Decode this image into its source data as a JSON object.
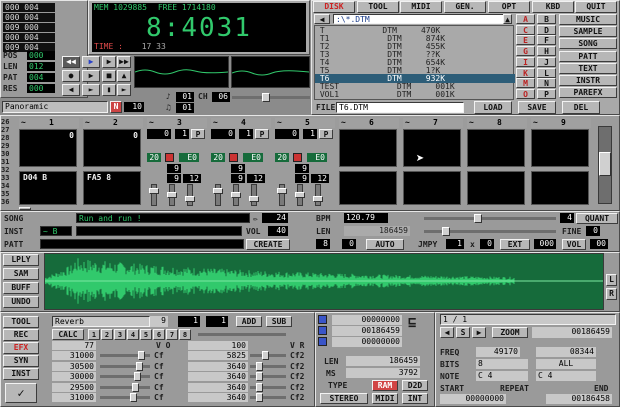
{
  "status": {
    "mem_label": "MEM",
    "mem_value": "1029885",
    "free_label": "FREE",
    "free_value": "1714180",
    "big_counter": "8:4031",
    "time_label": "TIME :",
    "time_value": "17 33",
    "left_digits": [
      "000 004",
      "000 004",
      "009 000",
      "000 004",
      "009 004"
    ]
  },
  "transport": {
    "labels": [
      {
        "name": "pos",
        "label": "POS",
        "value": "000"
      },
      {
        "name": "len",
        "label": "LEN",
        "value": "012"
      },
      {
        "name": "pat",
        "label": "PAT",
        "value": "004"
      },
      {
        "name": "res",
        "label": "RES",
        "value": "000"
      }
    ],
    "panoramic": "Panoramic",
    "n_label": "N",
    "n_value": "10",
    "oct_value": "01",
    "ch_label": "CH",
    "ch_value": "06",
    "ch2_value": "01"
  },
  "menu": {
    "tabs": [
      "DISK",
      "TOOL",
      "MIDI",
      "GEN.",
      "OPT",
      "KBD",
      "QUIT"
    ]
  },
  "disk": {
    "path": ":\\*.DTM",
    "files": [
      {
        "name": "T",
        "type": "DTM",
        "size": "470K"
      },
      {
        "name": "T1",
        "type": "DTM",
        "size": "874K"
      },
      {
        "name": "T2",
        "type": "DTM",
        "size": "455K"
      },
      {
        "name": "T3",
        "type": "DTM",
        "size": "??K"
      },
      {
        "name": "T4",
        "type": "DTM",
        "size": "654K"
      },
      {
        "name": "T5",
        "type": "DTM",
        "size": "1?K"
      },
      {
        "name": "T6",
        "type": "DTM",
        "size": "932K"
      },
      {
        "name": "TEST",
        "type": "DTM",
        "size": "001K"
      },
      {
        "name": "VOL1",
        "type": "DTM",
        "size": "001K"
      }
    ],
    "selected_index": 6,
    "drive_letters": [
      "A",
      "C",
      "E",
      "G",
      "I",
      "K",
      "M",
      "O",
      "B",
      "D",
      "F",
      "H",
      "J",
      "L",
      "N",
      "P"
    ],
    "file_label": "FILE",
    "file_value": "T6.DTM",
    "load": "LOAD",
    "save": "SAVE",
    "del": "DEL",
    "right_buttons": [
      "MUSIC",
      "SAMPLE",
      "SONG",
      "PATT",
      "TEXT",
      "INSTR",
      "PAREFX"
    ]
  },
  "tracks": {
    "numbers": [
      "1",
      "2",
      "3",
      "4",
      "5",
      "6",
      "7",
      "8",
      "9"
    ],
    "left_rows": [
      "26",
      "27",
      "28",
      "29",
      "30",
      "31",
      "32",
      "33",
      "34",
      "35",
      "36"
    ],
    "slot_values": [
      [
        "0",
        "",
        "0"
      ],
      [
        "0",
        "",
        "0"
      ],
      [
        "0",
        "1",
        "P"
      ],
      [
        "0",
        "1",
        "P"
      ],
      [
        "0",
        "1",
        "P"
      ],
      [
        "",
        "",
        ""
      ],
      [
        "",
        "",
        ""
      ],
      [
        "",
        "",
        ""
      ],
      [
        "",
        "",
        ""
      ]
    ],
    "mix_values": [
      {
        "a": "20",
        "b": "E0",
        "c": "9",
        "d": "9",
        "e": "12"
      },
      {
        "a": "20",
        "b": "E0",
        "c": "9",
        "d": "9",
        "e": "12"
      },
      {
        "a": "20",
        "b": "E0",
        "c": "9",
        "d": "9",
        "e": "12"
      }
    ],
    "notes": [
      {
        "track": "1",
        "text": "D04 B"
      },
      {
        "track": "2",
        "text": "FA5 8"
      }
    ]
  },
  "song": {
    "song_label": "SONG",
    "song_text": "Run and run !",
    "speed_value": "24",
    "bpm_label": "BPM",
    "bpm_value": "120.79",
    "quant_value": "4",
    "quant_label": "QUANT",
    "inst_label": "INST",
    "inst_value": "~ B",
    "vol_label": "VOL",
    "vol_value": "40",
    "len_label": "LEN",
    "len_value": "186459",
    "fine_label": "FINE",
    "fine_value": "0",
    "patt_label": "PATT",
    "create": "CREATE",
    "create_value": "8",
    "create_value2": "0",
    "auto": "AUTO",
    "jmpy_label": "JMPY",
    "jmpy_value": "1",
    "x_value": "0",
    "ext": "EXT",
    "ext_value": "000",
    "vol2_value": "00"
  },
  "sample_buttons": [
    "LPLY",
    "SAM",
    "BUFF",
    "UNDO"
  ],
  "sample_side": [
    "L",
    "R"
  ],
  "effects": {
    "left_buttons": [
      "TOOL",
      "REC",
      "EFX",
      "SYN",
      "INST"
    ],
    "effect_name": "Reverb",
    "effect_num": "9",
    "val_a": "1",
    "val_b": "1",
    "add": "ADD",
    "sub": "SUB",
    "calc": "CALC",
    "slots": [
      "1",
      "2",
      "3",
      "4",
      "5",
      "6",
      "7",
      "8"
    ],
    "param_col1_top": "77",
    "param_col2_top": "100",
    "rows": [
      {
        "a": "31000",
        "b": "Cf",
        "c": "5825",
        "d": "Cf2"
      },
      {
        "a": "30500",
        "b": "Cf",
        "c": "3640",
        "d": "Cf2"
      },
      {
        "a": "30000",
        "b": "Cf",
        "c": "3640",
        "d": "Cf2"
      },
      {
        "a": "29500",
        "b": "Cf",
        "c": "3640",
        "d": "Cf2"
      },
      {
        "a": "31000",
        "b": "Cf",
        "c": "3640",
        "d": "Cf2"
      }
    ],
    "vo": "V O",
    "vr": "V R"
  },
  "buffers": {
    "values": [
      "00000000",
      "00186459",
      "00000000"
    ],
    "len_label": "LEN",
    "len_value": "186459",
    "ms_label": "MS",
    "ms_value": "3792",
    "type_label": "TYPE",
    "ram": "RAM",
    "stereo": "STEREO",
    "midi": "MIDI",
    "d2d": "D2D",
    "int": "INT"
  },
  "zoom": {
    "page": "1 / 1",
    "zoom": "ZOOM",
    "zoom_value": "00186459",
    "freq_label": "FREQ",
    "freq_value": "49170",
    "freq2_value": "08344",
    "bits_label": "BITS",
    "bits_value": "8",
    "all": "ALL",
    "note_label": "NOTE",
    "note_value": "C 4",
    "note2_value": "C 4",
    "start": "START",
    "repeat": "REPEAT",
    "end": "END",
    "start_value": "00000000",
    "end_value": "00186458"
  },
  "colors": {
    "lcd_green": "#31c96c",
    "selection": "#2d5d78",
    "panel": "#a9a9a9"
  }
}
